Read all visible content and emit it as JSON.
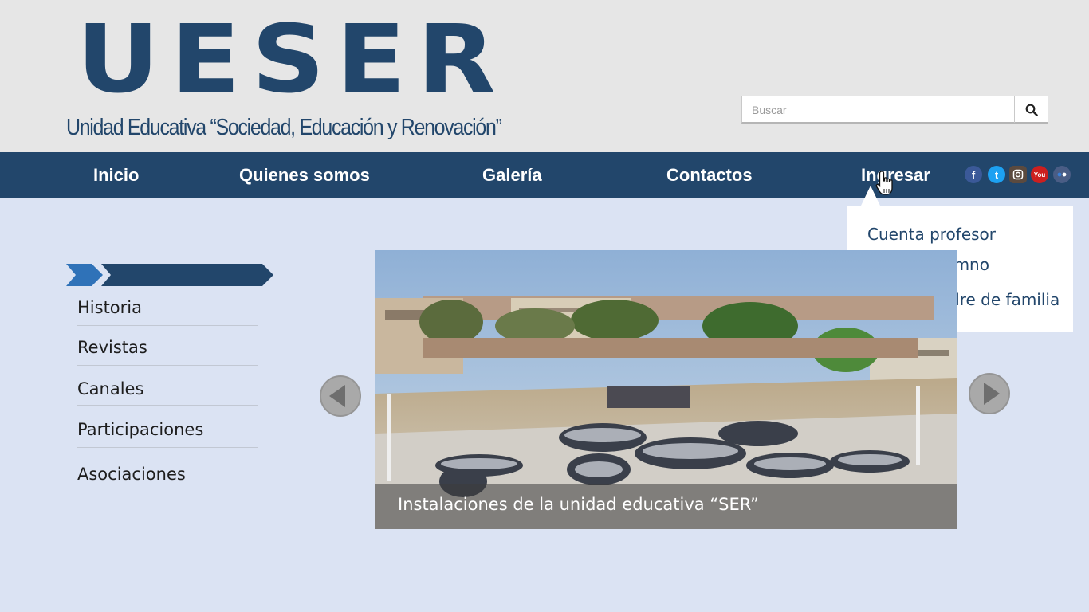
{
  "header": {
    "logo": "UESER",
    "subtitle": "Unidad Educativa “Sociedad, Educación y Renovación”",
    "search": {
      "placeholder": "Buscar",
      "button_icon": "search-icon"
    }
  },
  "nav": {
    "items": [
      {
        "label": "Inicio"
      },
      {
        "label": "Quienes somos"
      },
      {
        "label": "Galería"
      },
      {
        "label": "Contactos"
      },
      {
        "label": "Ingresar"
      }
    ],
    "social": [
      {
        "icon": "facebook-icon",
        "glyph": "f",
        "color": "#3b5998"
      },
      {
        "icon": "twitter-icon",
        "glyph": "t",
        "color": "#1da1f2"
      },
      {
        "icon": "instagram-icon",
        "glyph": "",
        "color": "#5b4a3f"
      },
      {
        "icon": "youtube-icon",
        "glyph": "You",
        "color": "#cc1f1f"
      },
      {
        "icon": "flickr-icon",
        "glyph": "",
        "color": "#4a5d85"
      }
    ]
  },
  "dropdown": {
    "items": [
      {
        "label": "Cuenta profesor"
      },
      {
        "label": "Cuenta alumno"
      },
      {
        "label": "Cuenta padre de familia"
      }
    ]
  },
  "sidebar": {
    "items": [
      {
        "label": "Historia"
      },
      {
        "label": "Revistas"
      },
      {
        "label": "Canales"
      },
      {
        "label": "Participaciones"
      },
      {
        "label": "Asociaciones"
      }
    ]
  },
  "slider": {
    "caption": "Instalaciones de la unidad educativa “SER”",
    "prev_icon": "arrow-left-icon",
    "next_icon": "arrow-right-icon"
  },
  "colors": {
    "brand": "#22466b",
    "header_bg": "#e6e6e6",
    "page_bg": "#dbe3f3",
    "accent_arrow": "#2f72b8"
  }
}
